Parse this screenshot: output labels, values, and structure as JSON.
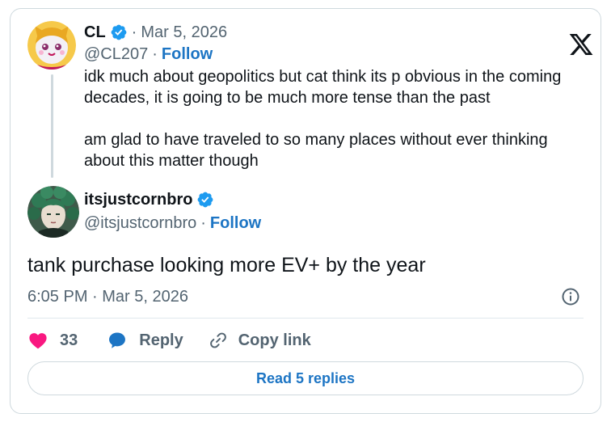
{
  "parent": {
    "name": "CL",
    "date": "Mar 5, 2026",
    "handle": "@CL207",
    "follow_label": "Follow",
    "text_lines": [
      "idk much about geopolitics but cat think its p obvious in the coming decades, it is going to be much more tense than the past",
      "am glad to have traveled to so many places without ever thinking about this matter though"
    ]
  },
  "reply": {
    "name": "itsjustcornbro",
    "handle": "@itsjustcornbro",
    "follow_label": "Follow",
    "text": "tank purchase looking more EV+ by the year",
    "timestamp": "6:05 PM · Mar 5, 2026"
  },
  "actions": {
    "like_count": "33",
    "reply_label": "Reply",
    "copy_label": "Copy link"
  },
  "read_replies_label": "Read 5 replies",
  "separator": "·",
  "icons": {
    "logo": "x-logo-icon",
    "verified": "verified-badge-icon",
    "info": "info-icon",
    "like": "heart-icon",
    "reply": "speech-bubble-icon",
    "copy": "link-icon"
  },
  "colors": {
    "accent": "#1d75c4",
    "verified": "#1d9bf0",
    "like": "#f91880",
    "muted": "#536471"
  }
}
